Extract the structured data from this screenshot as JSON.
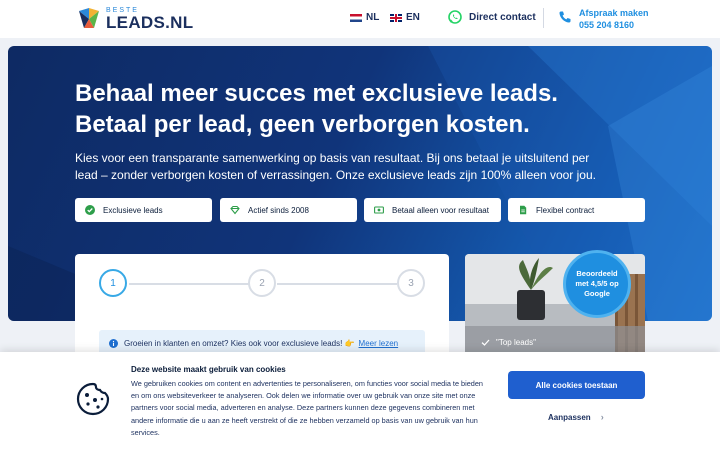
{
  "header": {
    "logo_top": "BESTE",
    "logo_main": "LEADS.NL",
    "lang_nl": "NL",
    "lang_en": "EN",
    "contact_label": "Direct contact",
    "appointment_label": "Afspraak maken",
    "appointment_phone": "055 204 8160"
  },
  "hero": {
    "title": "Behaal meer succes met exclusieve leads. Betaal per lead, geen verborgen kosten.",
    "subtitle": "Kies voor een transparante samenwerking op basis van resultaat. Bij ons betaal je uitsluitend per lead – zonder verborgen kosten of verrassingen. Onze exclusieve leads zijn 100% alleen voor jou.",
    "features": [
      {
        "label": "Exclusieve leads",
        "icon": "check-circle-icon"
      },
      {
        "label": "Actief sinds 2008",
        "icon": "diamond-icon"
      },
      {
        "label": "Betaal alleen voor resultaat",
        "icon": "money-icon"
      },
      {
        "label": "Flexibel contract",
        "icon": "document-icon"
      }
    ]
  },
  "form": {
    "steps": [
      "1",
      "2",
      "3"
    ],
    "active_step": 1,
    "info_text": "Groeien in klanten en omzet? Kies ook voor exclusieve leads! 👉",
    "info_link": "Meer lezen"
  },
  "photo": {
    "caption": "\"Top leads\"",
    "badge": "Beoordeeld met 4,5/5 op Google"
  },
  "cookie": {
    "title": "Deze website maakt gebruik van cookies",
    "text": "We gebruiken cookies om content en advertenties te personaliseren, om functies voor social media te bieden en om ons websiteverkeer te analyseren. Ook delen we informatie over uw gebruik van onze site met onze partners voor social media, adverteren en analyse. Deze partners kunnen deze gegevens combineren met andere informatie die u aan ze heeft verstrekt of die ze hebben verzameld op basis van uw gebruik van hun services.",
    "accept_label": "Alle cookies toestaan",
    "adjust_label": "Aanpassen",
    "adjust_chevron": "›"
  },
  "colors": {
    "brand_dark": "#1b2f5e",
    "accent_blue": "#1f8fe0",
    "button_blue": "#1f5fcf",
    "hero_start": "#0e2a63",
    "hero_end": "#1b78d6",
    "whatsapp_green": "#25d366"
  }
}
